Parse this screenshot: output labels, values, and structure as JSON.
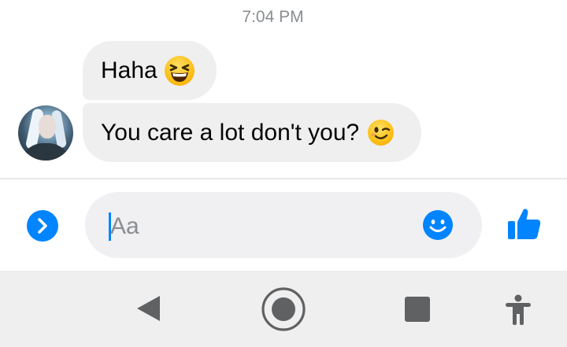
{
  "conversation": {
    "timestamp": "7:04 PM",
    "messages": [
      {
        "text": "Haha",
        "emoji": "grinning-squinting-face-emoji"
      },
      {
        "text": "You care a lot don't you?",
        "emoji": "winking-face-emoji"
      }
    ],
    "avatar": "contact-avatar"
  },
  "composer": {
    "expand_icon": "chevron-right-icon",
    "placeholder": "Aa",
    "emoji_icon": "smiley-icon",
    "like_icon": "thumbs-up-icon"
  },
  "navbar": {
    "buttons": [
      "back-icon",
      "home-icon",
      "recents-icon",
      "accessibility-icon"
    ]
  },
  "colors": {
    "accent": "#0084ff",
    "bubble": "#efeff0",
    "navbar": "#efefef",
    "timestamp": "#8a8d91"
  }
}
